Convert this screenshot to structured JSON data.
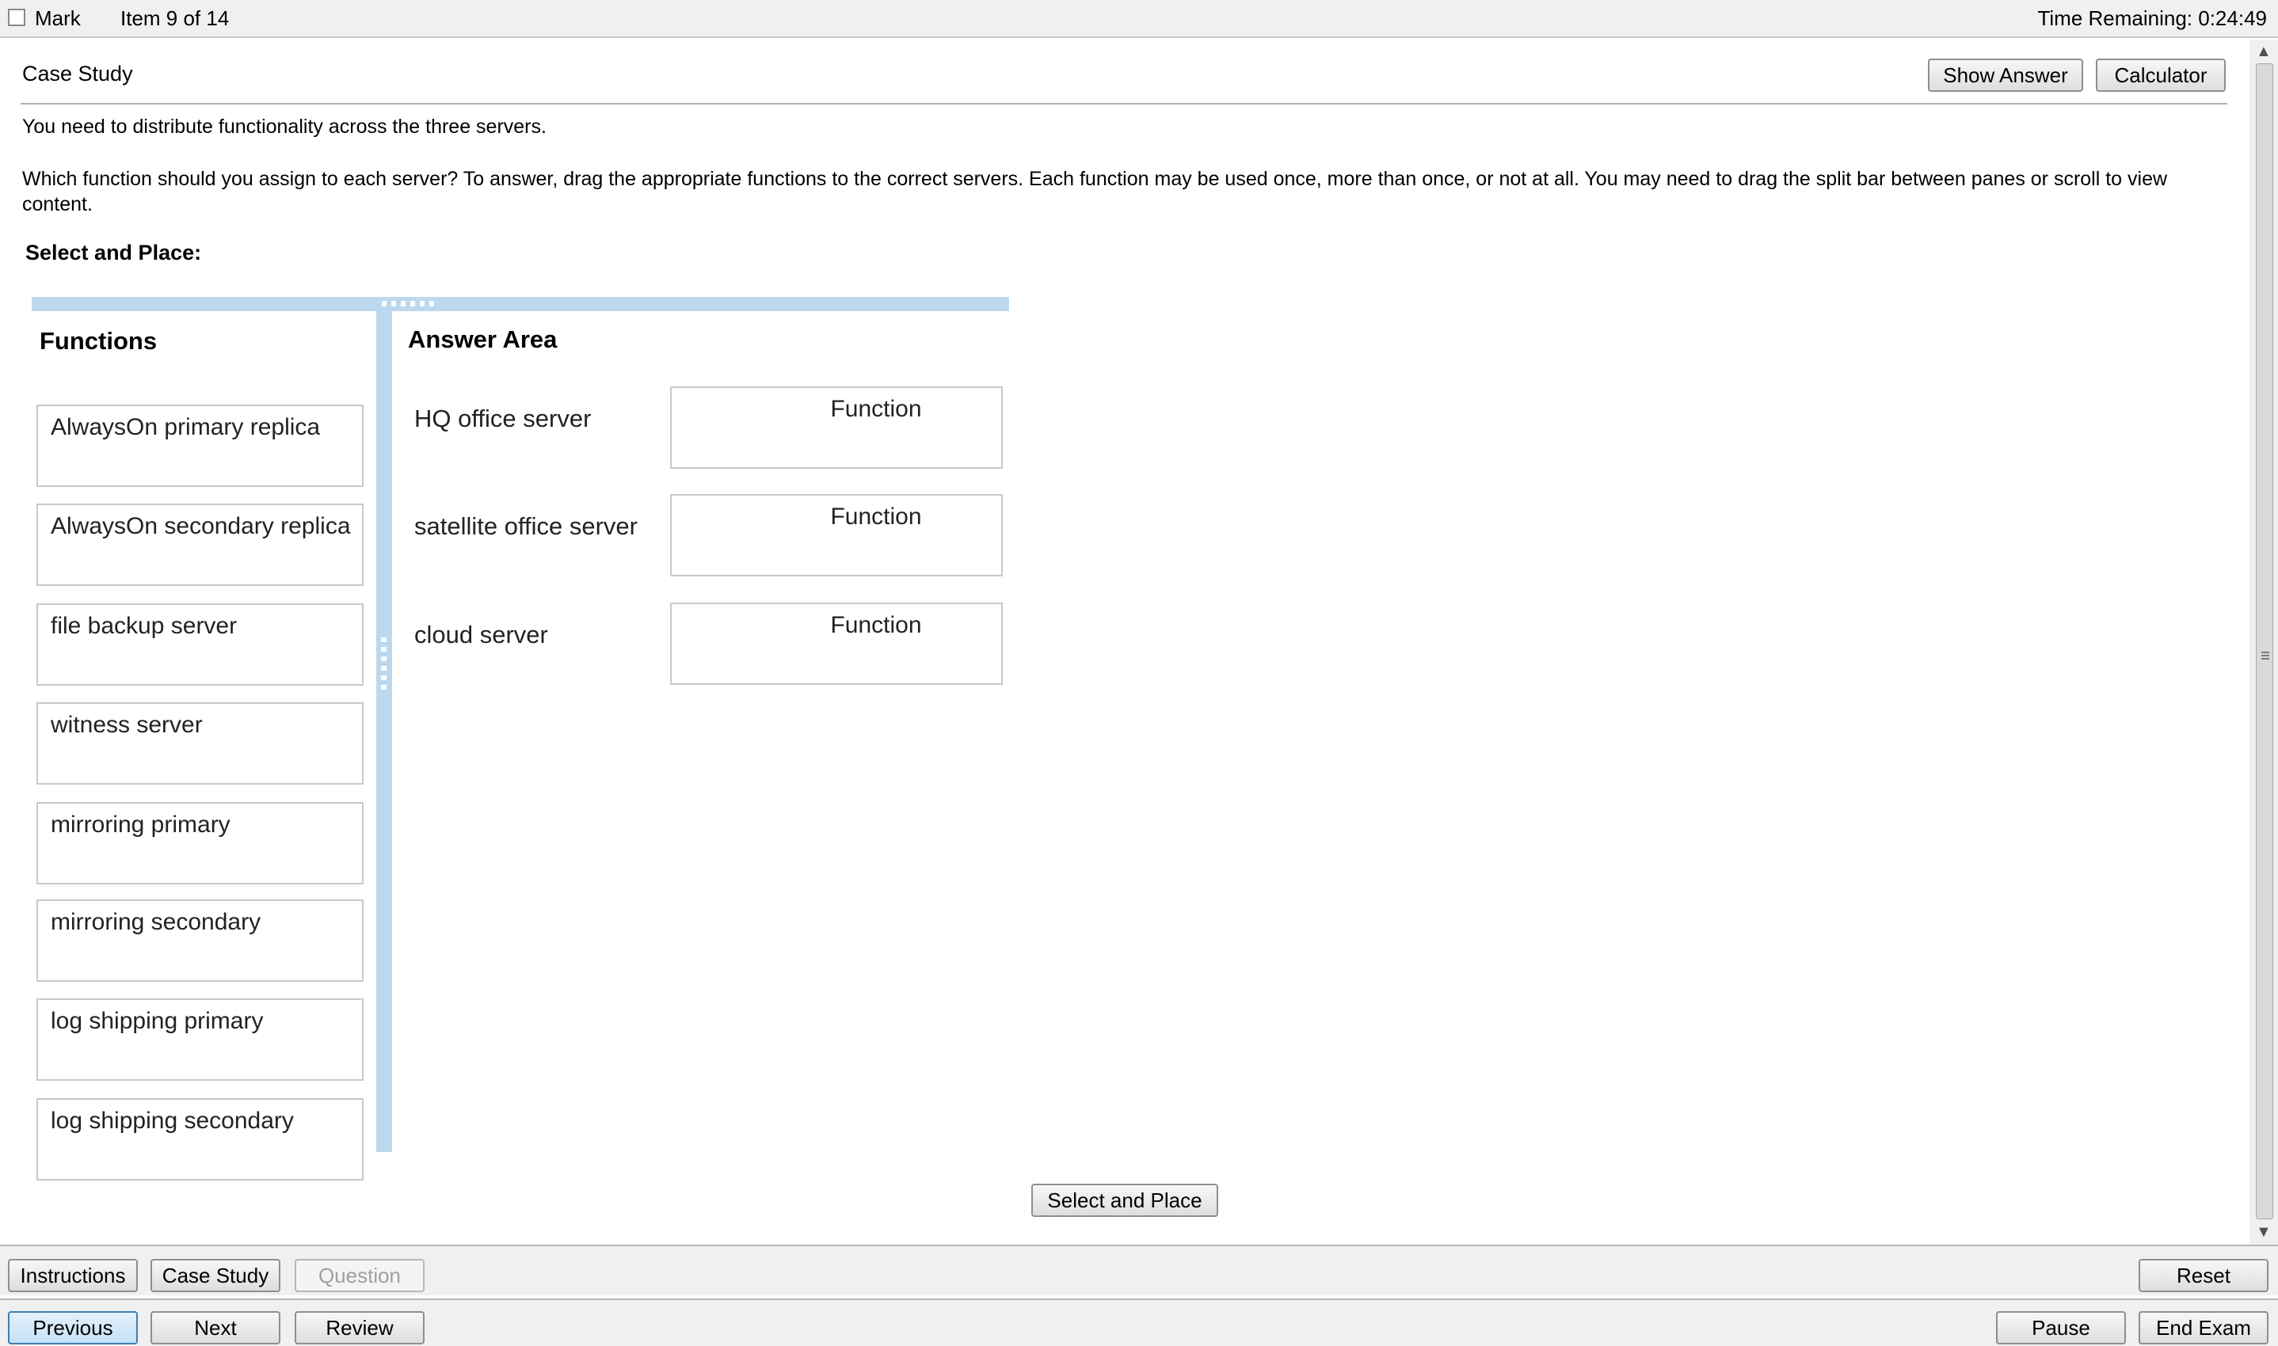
{
  "top_bar": {
    "mark_label": "Mark",
    "item_label": "Item 9 of 14",
    "time_remaining": "Time Remaining: 0:24:49"
  },
  "content": {
    "section_title": "Case Study",
    "show_answer_label": "Show Answer",
    "calculator_label": "Calculator",
    "prompt_line": "You need to distribute functionality across the three servers.",
    "instructions": "Which function should you assign to each server? To answer, drag the appropriate functions to the correct servers. Each function may be used once, more than once, or not at all. You may need to drag the split bar between panes or scroll to view content.",
    "select_place_heading": "Select and Place:",
    "select_place_button": "Select and Place"
  },
  "drag_drop": {
    "functions_heading": "Functions",
    "answer_heading": "Answer Area",
    "functions": [
      "AlwaysOn primary replica",
      "AlwaysOn secondary replica",
      "file backup server",
      "witness server",
      "mirroring primary",
      "mirroring secondary",
      "log shipping primary",
      "log shipping secondary"
    ],
    "servers": [
      {
        "label": "HQ office server",
        "target": "Function"
      },
      {
        "label": "satellite office server",
        "target": "Function"
      },
      {
        "label": "cloud server",
        "target": "Function"
      }
    ]
  },
  "bottom_bar": {
    "instructions_label": "Instructions",
    "case_study_label": "Case Study",
    "question_label": "Question",
    "reset_label": "Reset",
    "previous_label": "Previous",
    "next_label": "Next",
    "review_label": "Review",
    "pause_label": "Pause",
    "end_exam_label": "End Exam"
  }
}
